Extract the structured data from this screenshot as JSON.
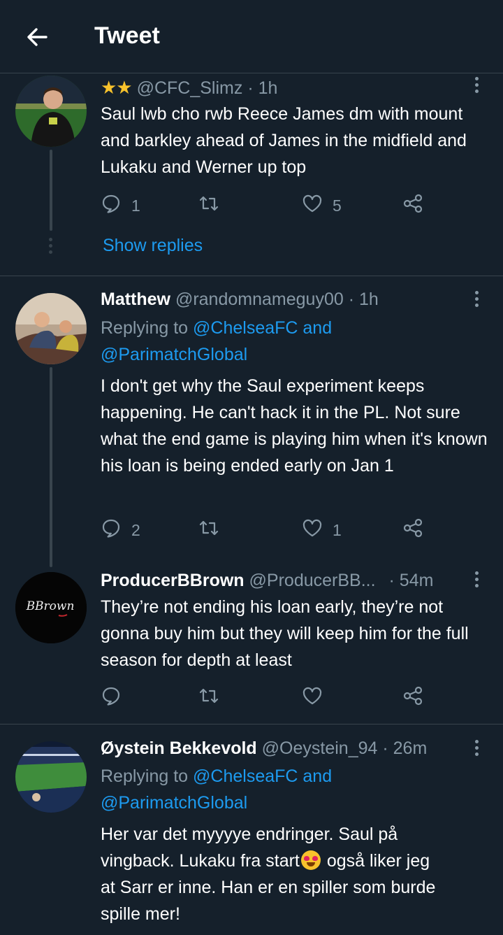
{
  "header": {
    "title": "Tweet"
  },
  "tweets": [
    {
      "stars": "★★",
      "name": "",
      "handle": "@CFC_Slimz",
      "time": "· 1h",
      "replying_prefix": "",
      "replying_links": "",
      "replying_links2": "",
      "text": "Saul lwb cho rwb Reece James dm with mount and barkley ahead of James in the midfield and Lukaku and Werner up top",
      "reply_count": "1",
      "retweet_count": "",
      "like_count": "5",
      "show_replies": "Show replies"
    },
    {
      "name": "Matthew",
      "handle": "@randomnameguy00",
      "time": "· 1h",
      "replying_prefix": "Replying to ",
      "replying_links": "@ChelseaFC and",
      "replying_links2": "@ParimatchGlobal",
      "text": "I don't get why the Saul experiment keeps happening.  He can't hack it in the PL.  Not sure what the end game is playing him when it's known his loan is being ended early on Jan 1",
      "reply_count": "2",
      "retweet_count": "",
      "like_count": "1"
    },
    {
      "name": "ProducerBBrown",
      "handle": "@ProducerBB...",
      "time": "· 54m",
      "avatar_text": "BBrown",
      "text": "They’re not ending his loan early, they’re not gonna buy him but they will keep him for the full season for depth at least",
      "reply_count": "",
      "retweet_count": "",
      "like_count": ""
    },
    {
      "name": "Øystein Bekkevold",
      "handle": "@Oeystein_94",
      "time": "· 26m",
      "replying_prefix": "Replying to ",
      "replying_links": "@ChelseaFC and",
      "replying_links2": "@ParimatchGlobal",
      "text_line1": "Her var det myyyye endringer. Saul på",
      "text_line2a": "vingback. Lukaku fra start",
      "text_line2b": " også liker jeg",
      "text_line3": "at Sarr er inne. Han er en spiller som burde",
      "text_line4": "spille mer!"
    }
  ],
  "colors": {
    "background": "#15202b",
    "accent": "#1d9bf0",
    "muted": "#8899a6",
    "divider": "#38444d",
    "star": "#f7c22c"
  },
  "icons": [
    "back-arrow-icon",
    "more-vertical-icon",
    "reply-icon",
    "retweet-icon",
    "like-icon",
    "share-icon",
    "star-icon",
    "heart-eyes-emoji-icon"
  ]
}
